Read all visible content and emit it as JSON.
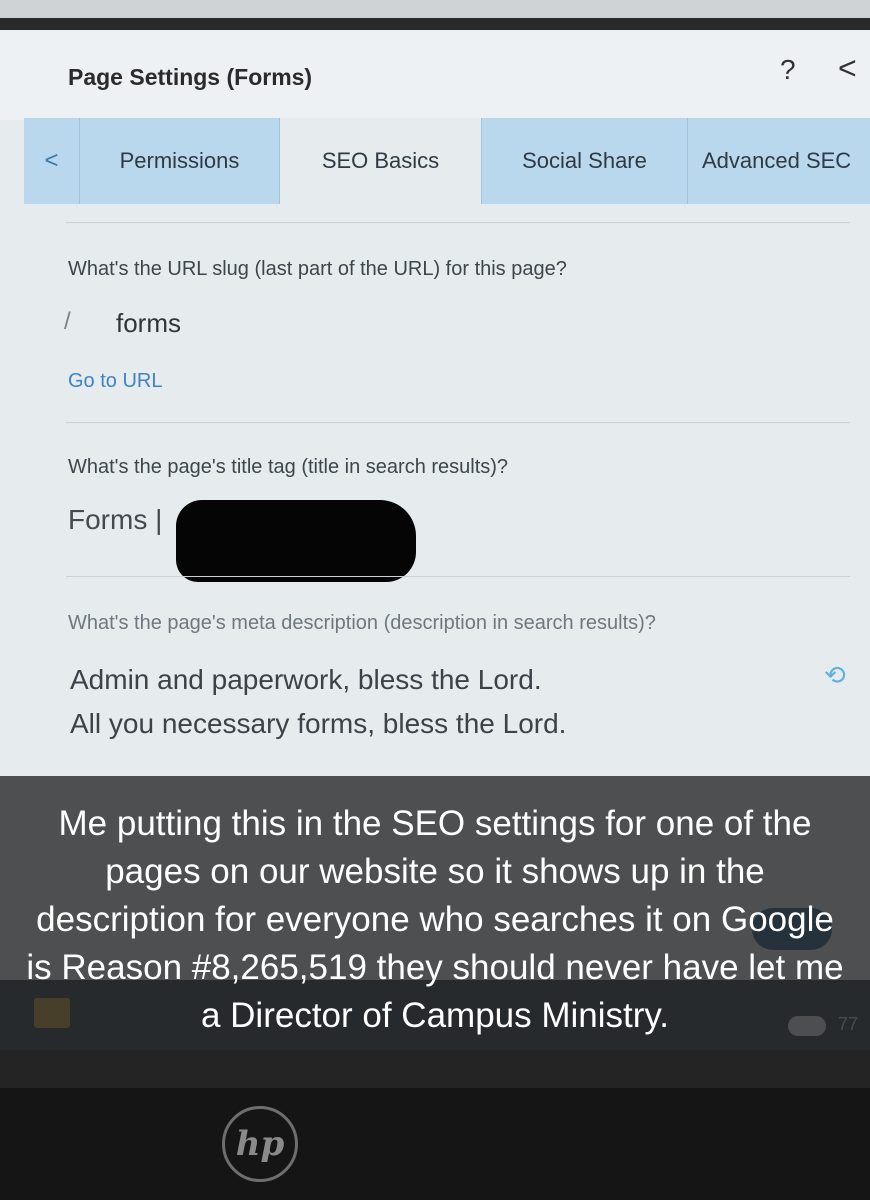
{
  "dialog": {
    "title": "Page Settings (Forms)",
    "help_label": "?",
    "back_label": "<"
  },
  "tabs": {
    "prev_label": "<",
    "items": [
      {
        "label": "Permissions"
      },
      {
        "label": "SEO Basics"
      },
      {
        "label": "Social Share"
      },
      {
        "label": "Advanced SEC"
      }
    ],
    "active": "SEO Basics"
  },
  "url_section": {
    "question": "What's the URL slug (last part of the URL) for this page?",
    "prefix": "/",
    "value": "forms",
    "link": "Go to URL"
  },
  "title_section": {
    "question": "What's the page's title tag (title in search results)?",
    "value": "Forms |"
  },
  "meta_section": {
    "question": "What's the page's meta description (description in search results)?",
    "line1": "Admin and paperwork, bless the Lord.",
    "line2": "All you necessary forms, bless the Lord.",
    "reset_icon": "refresh-icon"
  },
  "taskbar": {
    "temperature": "77"
  },
  "laptop": {
    "logo": "hp"
  },
  "caption": {
    "text": "Me putting this in the SEO settings for one of the pages on our website so it shows up in the description for everyone who searches it on Google is Reason #8,265,519 they should never have let me a Director of Campus Ministry."
  },
  "colors": {
    "tab_background": "#b9d8ee",
    "link": "#3f83c6",
    "taskbar": "#1e3244"
  }
}
